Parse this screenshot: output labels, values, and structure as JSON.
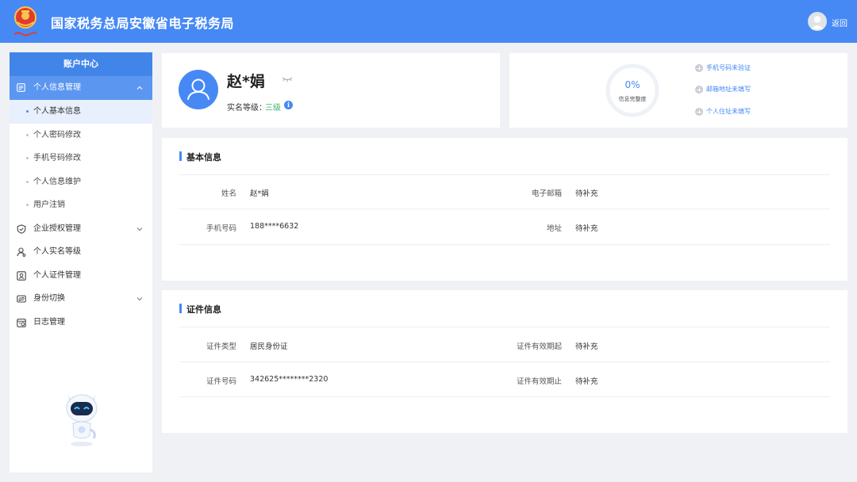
{
  "header": {
    "title": "国家税务总局安徽省电子税务局",
    "back_label": "返回"
  },
  "sidebar": {
    "heading": "账户中心",
    "group": {
      "label": "个人信息管理",
      "items": [
        {
          "label": "个人基本信息",
          "active": true
        },
        {
          "label": "个人密码修改"
        },
        {
          "label": "手机号码修改"
        },
        {
          "label": "个人信息维护"
        },
        {
          "label": "用户注销"
        }
      ]
    },
    "menu": [
      {
        "label": "企业授权管理",
        "icon": "shield-check-icon",
        "expandable": true
      },
      {
        "label": "个人实名等级",
        "icon": "person-icon"
      },
      {
        "label": "个人证件管理",
        "icon": "id-card-icon"
      },
      {
        "label": "身份切换",
        "icon": "switch-icon",
        "expandable": true
      },
      {
        "label": "日志管理",
        "icon": "log-icon"
      }
    ]
  },
  "profile": {
    "name": "赵*娟",
    "level_label": "实名等级：",
    "level_value": "三级"
  },
  "completeness": {
    "percent": "0%",
    "label": "信息完整度",
    "value": 0,
    "todos": [
      "手机号码未验证",
      "邮箱地址未填写",
      "个人住址未填写"
    ]
  },
  "basic_info": {
    "title": "基本信息",
    "rows": [
      {
        "label": "姓名",
        "value": "赵*娟",
        "label2": "电子邮箱",
        "value2": "待补充"
      },
      {
        "label": "手机号码",
        "value": "188****6632",
        "label2": "地址",
        "value2": "待补充"
      }
    ]
  },
  "cert_info": {
    "title": "证件信息",
    "rows": [
      {
        "label": "证件类型",
        "value": "居民身份证",
        "label2": "证件有效期起",
        "value2": "待补充"
      },
      {
        "label": "证件号码",
        "value": "342625********2320",
        "label2": "证件有效期止",
        "value2": "待补充"
      }
    ]
  },
  "colors": {
    "brand_blue": "#4689f5",
    "level_green": "#3bb56b"
  }
}
